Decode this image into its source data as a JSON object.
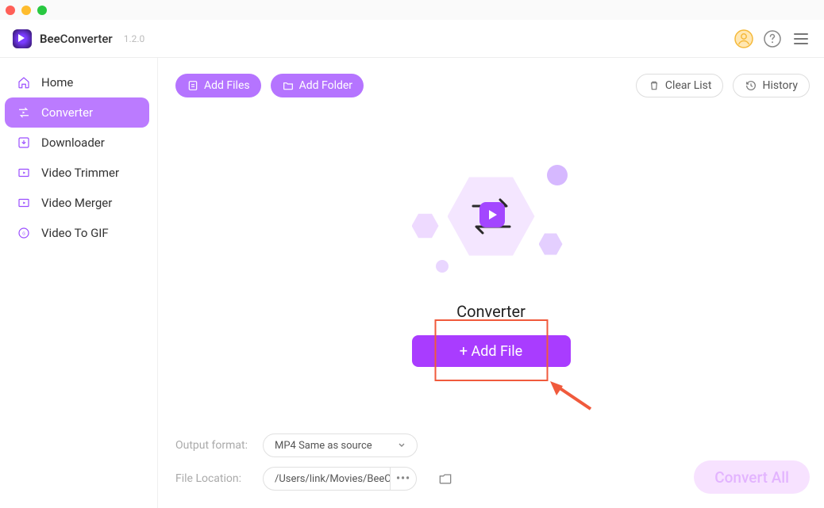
{
  "app": {
    "brand_a": "Bee",
    "brand_b": "Converter",
    "version": "1.2.0"
  },
  "sidebar": {
    "items": [
      {
        "label": "Home"
      },
      {
        "label": "Converter"
      },
      {
        "label": "Downloader"
      },
      {
        "label": "Video Trimmer"
      },
      {
        "label": "Video Merger"
      },
      {
        "label": "Video To GIF"
      }
    ]
  },
  "topbar": {
    "add_files": "Add Files",
    "add_folder": "Add Folder",
    "clear_list": "Clear List",
    "history": "History"
  },
  "stage": {
    "title": "Converter",
    "add_file_btn": "+ Add File"
  },
  "footer": {
    "output_label": "Output format:",
    "output_value": "MP4 Same as source",
    "location_label": "File Location:",
    "location_value": "/Users/link/Movies/BeeC",
    "convert_all": "Convert All"
  }
}
